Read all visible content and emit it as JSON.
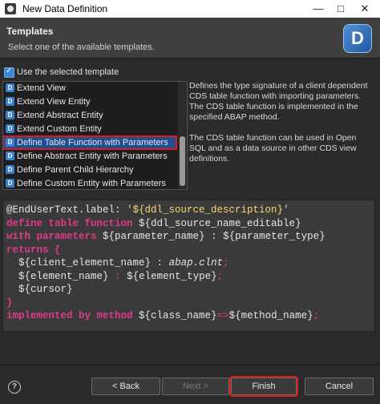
{
  "window": {
    "title": "New Data Definition",
    "minimize": "—",
    "maximize": "□",
    "close": "✕"
  },
  "header": {
    "title": "Templates",
    "description": "Select one of the available templates.",
    "logo_letter": "D"
  },
  "use_template": {
    "label": "Use the selected template",
    "checked": true
  },
  "templates": [
    {
      "label": "Extend View"
    },
    {
      "label": "Extend View Entity"
    },
    {
      "label": "Extend Abstract Entity"
    },
    {
      "label": "Extend Custom Entity"
    },
    {
      "label": "Define Table Function with Parameters",
      "selected": true
    },
    {
      "label": "Define Abstract Entity with Parameters"
    },
    {
      "label": "Define Parent Child Hierarchy"
    },
    {
      "label": "Define Custom Entity with Parameters"
    }
  ],
  "description": {
    "p1": "Defines the type signature of a client dependent CDS table function with importing parameters. The CDS table function is implemented in the specified ABAP method.",
    "p2": "The CDS table function can be used in Open SQL and as a data source in other CDS view definitions."
  },
  "code": {
    "l1_a": "@EndUserText.label: ",
    "l1_b": "'${ddl_source_description}'",
    "l2_a": "define table function ",
    "l2_b": "${ddl_source_name_editable}",
    "l3_a": "with parameters ",
    "l3_b": "${parameter_name}",
    "l3_c": " : ",
    "l3_d": "${parameter_type}",
    "l4": "returns {",
    "l5_a": "${client_element_name}",
    "l5_b": " : ",
    "l5_c": "abap.clnt",
    "l5_d": ";",
    "l6_a": "${element_name}",
    "l6_b": " : ",
    "l6_c": "${element_type}",
    "l6_d": ";",
    "l7": "${cursor}",
    "l8": "}",
    "l9_a": "implemented by method ",
    "l9_b": "${class_name}",
    "l9_c": "=>",
    "l9_d": "${method_name}",
    "l9_e": ";"
  },
  "buttons": {
    "help": "?",
    "back": "< Back",
    "next": "Next >",
    "finish": "Finish",
    "cancel": "Cancel"
  },
  "colors": {
    "keyword": "#e03a8a",
    "string": "#f7d774",
    "highlight": "#e0191e",
    "selection": "#1f4f8f"
  }
}
